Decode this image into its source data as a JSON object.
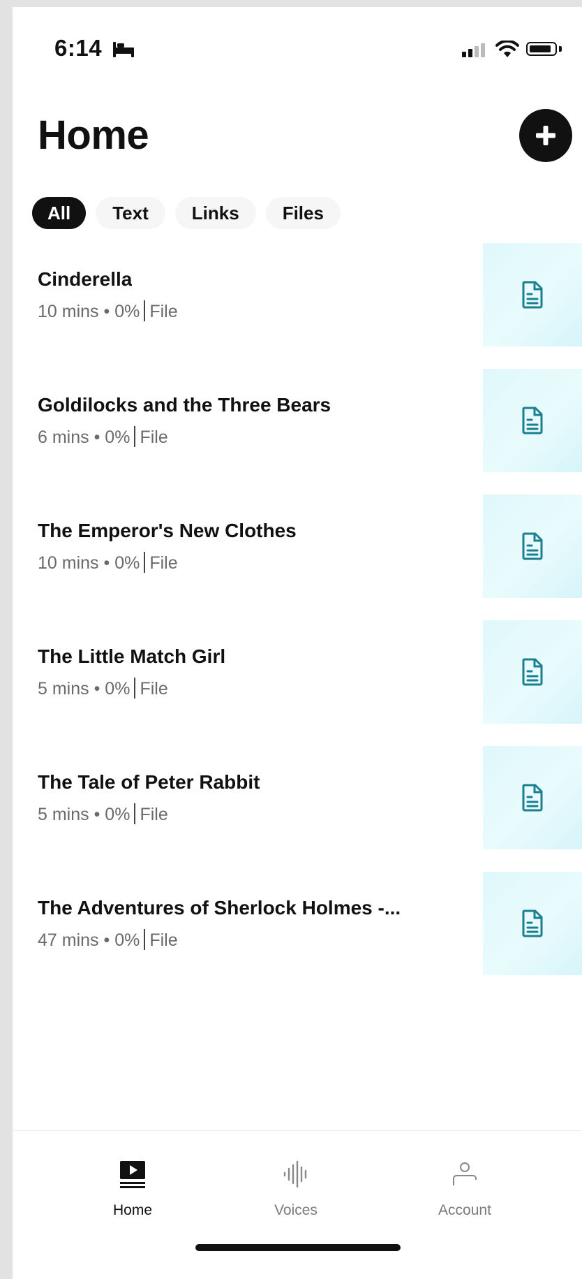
{
  "status_bar": {
    "time": "6:14"
  },
  "header": {
    "title": "Home"
  },
  "filters": [
    {
      "label": "All",
      "active": true
    },
    {
      "label": "Text",
      "active": false
    },
    {
      "label": "Links",
      "active": false
    },
    {
      "label": "Files",
      "active": false
    }
  ],
  "items": [
    {
      "title": "Cinderella",
      "duration": "10 mins",
      "progress": "0%",
      "type": "File"
    },
    {
      "title": "Goldilocks and the Three Bears",
      "duration": "6 mins",
      "progress": "0%",
      "type": "File"
    },
    {
      "title": "The Emperor's New Clothes",
      "duration": "10 mins",
      "progress": "0%",
      "type": "File"
    },
    {
      "title": "The Little Match Girl",
      "duration": "5 mins",
      "progress": "0%",
      "type": "File"
    },
    {
      "title": "The Tale of Peter Rabbit",
      "duration": "5 mins",
      "progress": "0%",
      "type": "File"
    },
    {
      "title": "The Adventures of Sherlock Holmes -...",
      "duration": "47 mins",
      "progress": "0%",
      "type": "File"
    }
  ],
  "tabbar": {
    "home": "Home",
    "voices": "Voices",
    "account": "Account"
  },
  "colors": {
    "accent": "#1a7f8f",
    "thumb_bg": "#e3f9fc"
  },
  "icons": {
    "add": "plus-icon",
    "item": "document-icon",
    "home": "play-screen-icon",
    "voices": "waveform-icon",
    "account": "person-icon"
  }
}
